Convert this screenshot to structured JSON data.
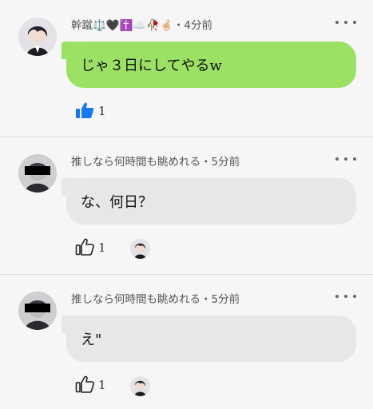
{
  "comments": [
    {
      "author": "幹蹴⚖️🖤✝️☁️🥀🤞🏻",
      "time": "・4分前",
      "text": "じゃ３日にしてやるw",
      "likes": "1",
      "liked": true,
      "bubble_color": "#9be164"
    },
    {
      "author": "推しなら何時間も眺めれる",
      "time": "・5分前",
      "text": "な、何日？",
      "likes": "1",
      "liked": false,
      "bubble_color": "#e7e7ea"
    },
    {
      "author": "推しなら何時間も眺めれる",
      "time": "・5分前",
      "text": "え\"",
      "likes": "1",
      "liked": false,
      "bubble_color": "#e7e7ea"
    }
  ],
  "colors": {
    "accent_like": "#1877f2",
    "background": "#f6f6f6"
  },
  "icons": {
    "like": "thumbs-up-icon",
    "more": "more-options-icon"
  }
}
